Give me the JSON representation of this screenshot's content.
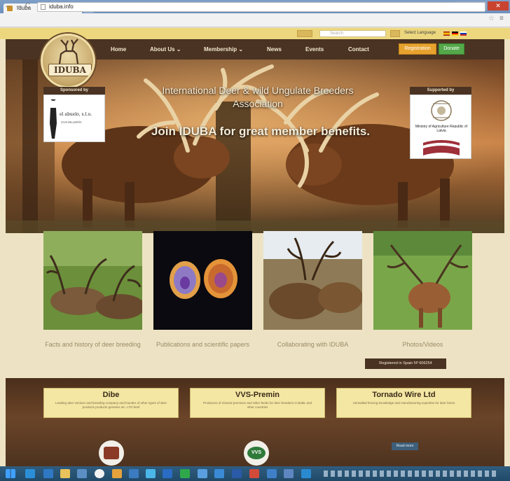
{
  "browser": {
    "tab_title": "Iduba",
    "tab_close": "×",
    "url": "iduba.info",
    "window_controls": [
      "–",
      "□",
      "✕"
    ]
  },
  "site": {
    "search_placeholder": "Search",
    "language_label": "Select Language",
    "logo_text": "IDUBA",
    "nav": [
      "Home",
      "About Us ⌄",
      "Membership ⌄",
      "News",
      "Events",
      "Contact"
    ],
    "register_button": "Registration",
    "donate_button": "Donate",
    "hero": {
      "title": "International Deer & wild Ungulate Breeders Association",
      "subtitle": "Join IDUBA for great member benefits.",
      "sponsor_left": {
        "header": "Sponsored by",
        "logo_text": "el abuelo, s.l.u.",
        "logo_sub": "CUCHILLERÍA"
      },
      "sponsor_right": {
        "header": "Supported by",
        "logo_text": "Ministry of Agriculture Republic of Latvia"
      }
    },
    "cards": [
      {
        "caption": "Facts and history of deer breeding",
        "image": "deer-herd-antlers"
      },
      {
        "caption": "Publications and scientific papers",
        "image": "antler-cross-sections"
      },
      {
        "caption": "Collaborating with IDUBA",
        "image": "stag-herd"
      },
      {
        "caption": "Photos/Videos",
        "image": "trophy-stag-meadow"
      }
    ],
    "registered_badge": "Registered in Spain Nº 606254",
    "partners": [
      {
        "name": "Dibe",
        "desc": "Leading deer venison and breeding company and founder of other types of deer products products genetics etc. LTD beef"
      },
      {
        "name": "VVS-Premin",
        "desc": "Producers of mineral premixes and other feeds for deer breeders in Baltic and other countries"
      },
      {
        "name": "Tornado Wire Ltd",
        "desc": "Unrivalled fencing knowledge and manufacturing expertise for deer farms"
      }
    ],
    "more_button": "Read more",
    "partner_logo_2_text": "VVS"
  },
  "colors": {
    "nav_bg": "#4a3322",
    "page_bg": "#ede3c4",
    "accent_gold": "#ecd77e",
    "register_orange": "#e7a22e",
    "donate_green": "#54a84a"
  }
}
